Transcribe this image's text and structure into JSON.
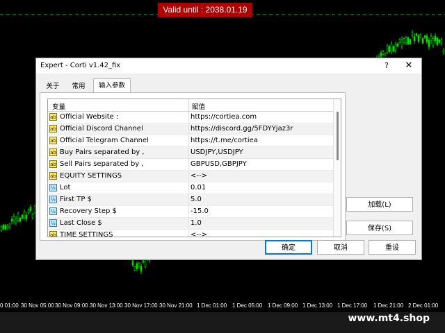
{
  "chart": {
    "valid_label": "Valid until : 2038.01.19",
    "time_labels": [
      "0 01:00",
      "30 Nov 05:00",
      "30 Nov 09:00",
      "30 Nov 13:00",
      "30 Nov 17:00",
      "30 Nov 21:00",
      "1 Dec 01:00",
      "1 Dec 05:00",
      "1 Dec 09:00",
      "1 Dec 13:00",
      "1 Dec 17:00",
      "1 Dec 21:00",
      "2 Dec 01:00"
    ],
    "watermark": "www.mt4.shop",
    "colors": {
      "background": "#000000",
      "candles": "#00e000",
      "level_line": "#00c000",
      "valid_box": "#b00000"
    }
  },
  "dialog": {
    "title": "Expert - Corti v1.42_fix",
    "help_glyph": "?",
    "close_glyph": "✕",
    "tabs": [
      {
        "label": "关于",
        "active": false
      },
      {
        "label": "常用",
        "active": false
      },
      {
        "label": "输入参数",
        "active": true
      }
    ],
    "table": {
      "header_variable": "变量",
      "header_value": "赋值",
      "rows": [
        {
          "icon": "ab",
          "variable": "Official Website :",
          "value": "https://cortiea.com"
        },
        {
          "icon": "ab",
          "variable": "Official Discord Channel",
          "value": "https://discord.gg/5FDYYjaz3r"
        },
        {
          "icon": "ab",
          "variable": "Official Telegram Channel",
          "value": "https://t.me/cortiea"
        },
        {
          "icon": "ab",
          "variable": "Buy Pairs separated by ,",
          "value": "USDJPY,USDJPY"
        },
        {
          "icon": "ab",
          "variable": "Sell Pairs separated by ,",
          "value": "GBPUSD,GBPJPY"
        },
        {
          "icon": "ab",
          "variable": "EQUITY SETTINGS",
          "value": "<-->"
        },
        {
          "icon": "½",
          "variable": "Lot",
          "value": "0.01"
        },
        {
          "icon": "½",
          "variable": "First TP $",
          "value": "5.0"
        },
        {
          "icon": "½",
          "variable": "Recovery Step $",
          "value": "-15.0"
        },
        {
          "icon": "½",
          "variable": "Last Close $",
          "value": "1.0"
        },
        {
          "icon": "ab",
          "variable": "TIME SETTINGS",
          "value": "<-->"
        }
      ]
    },
    "load_button": "加载(L)",
    "save_button": "保存(S)",
    "ok_button": "确定",
    "cancel_button": "取消",
    "reset_button": "重设"
  }
}
